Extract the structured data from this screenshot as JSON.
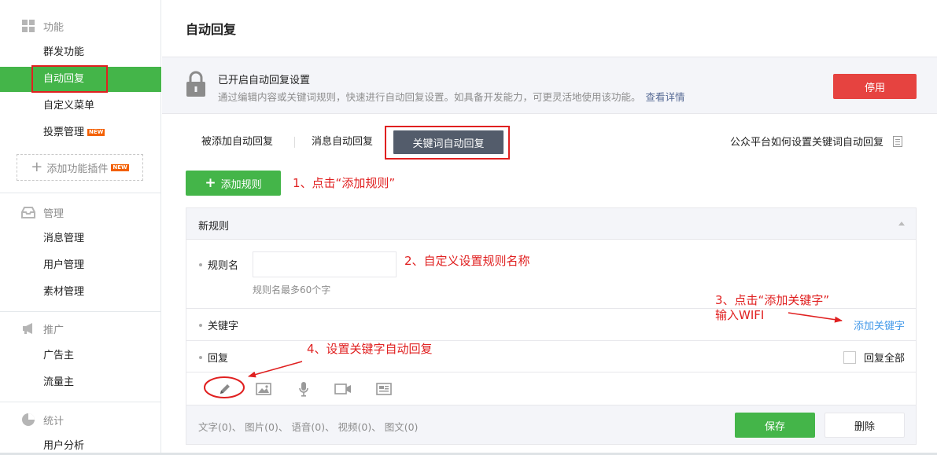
{
  "sidebar": {
    "sections": [
      {
        "title": "功能",
        "icon": "grid-icon",
        "items": [
          "群发功能",
          "自动回复",
          "自定义菜单",
          "投票管理"
        ]
      },
      {
        "title": "管理",
        "icon": "inbox-icon",
        "items": [
          "消息管理",
          "用户管理",
          "素材管理"
        ]
      },
      {
        "title": "推广",
        "icon": "megaphone-icon",
        "items": [
          "广告主",
          "流量主"
        ]
      },
      {
        "title": "统计",
        "icon": "pie-chart-icon",
        "items": [
          "用户分析"
        ]
      }
    ],
    "new_badge": "NEW",
    "add_plugin_label": "添加功能插件",
    "active_item": "自动回复"
  },
  "main": {
    "page_title": "自动回复",
    "banner": {
      "title": "已开启自动回复设置",
      "description": "通过编辑内容或关键词规则，快速进行自动回复设置。如具备开发能力，可更灵活地使用该功能。",
      "link": "查看详情",
      "disable_button": "停用"
    },
    "tabs": [
      "被添加自动回复",
      "消息自动回复",
      "关键词自动回复"
    ],
    "active_tab": "关键词自动回复",
    "help_link": "公众平台如何设置关键词自动回复",
    "add_rule_button": "添加规则",
    "rule": {
      "header": "新规则",
      "name_label": "规则名",
      "name_value": "",
      "name_hint": "规则名最多60个字",
      "keyword_label": "关键字",
      "add_keyword": "添加关键字",
      "reply_label": "回复",
      "reply_all": "回复全部",
      "tools": [
        "pencil-icon",
        "image-icon",
        "microphone-icon",
        "video-icon",
        "news-icon"
      ],
      "counts": "文字(0)、 图片(0)、 语音(0)、 视频(0)、 图文(0)",
      "save_button": "保存",
      "delete_button": "删除"
    }
  },
  "annotations": {
    "step1": "1、点击“添加规则”",
    "step2": "2、自定义设置规则名称",
    "step3_line1": "3、点击“添加关键字”",
    "step3_line2": "输入WIFI",
    "step4": "4、设置关键字自动回复",
    "color": "#e02020"
  },
  "colors": {
    "accent_green": "#44b549",
    "danger_red": "#e64340",
    "tab_active": "#535c6b",
    "link_blue": "#459ae9"
  }
}
